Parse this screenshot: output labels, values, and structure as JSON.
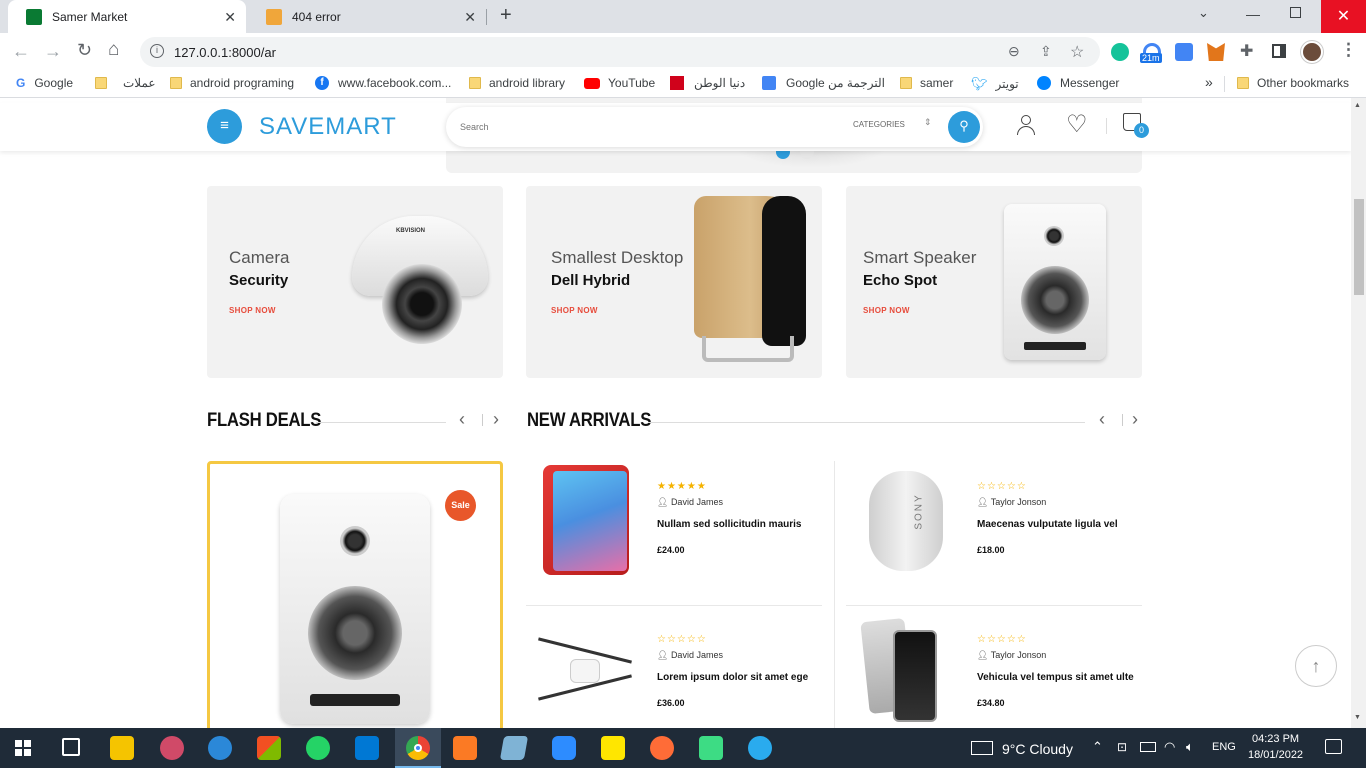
{
  "browser": {
    "tabs": [
      {
        "title": "Samer Market",
        "active": true
      },
      {
        "title": "404 error",
        "active": false
      }
    ],
    "new_tab_icon": "plus-icon",
    "url": "127.0.0.1:8000/ar",
    "extension_badge": "21m",
    "bookmarks": [
      {
        "label": "Google",
        "icon": "google-icon"
      },
      {
        "label": "عملات",
        "icon": "folder-icon"
      },
      {
        "label": "android programing",
        "icon": "folder-icon"
      },
      {
        "label": "www.facebook.com...",
        "icon": "facebook-icon"
      },
      {
        "label": "android library",
        "icon": "folder-icon"
      },
      {
        "label": "YouTube",
        "icon": "youtube-icon"
      },
      {
        "label": "دنيا الوطن",
        "icon": "site-icon"
      },
      {
        "label": "Google الترجمة من",
        "icon": "translate-icon"
      },
      {
        "label": "samer",
        "icon": "folder-icon"
      },
      {
        "label": "تويتر",
        "icon": "twitter-icon"
      },
      {
        "label": "Messenger",
        "icon": "messenger-icon"
      }
    ],
    "more_bookmarks": "»",
    "other_bookmarks": "Other bookmarks"
  },
  "site": {
    "logo": "SAVEMART",
    "search_placeholder": "Search",
    "categories_label": "CATEGORIES",
    "cart_count": "0",
    "accent": "#2d9cdb"
  },
  "banners": [
    {
      "subtitle": "Camera",
      "title": "Security",
      "cta": "SHOP NOW",
      "brand": "KBVISION"
    },
    {
      "subtitle": "Smallest Desktop",
      "title": "Dell Hybrid",
      "cta": "SHOP NOW"
    },
    {
      "subtitle": "Smart Speaker",
      "title": "Echo Spot",
      "cta": "SHOP NOW"
    }
  ],
  "flash_deals": {
    "heading": "FLASH DEALS",
    "badge": "Sale"
  },
  "new_arrivals": {
    "heading": "NEW ARRIVALS",
    "products": [
      {
        "author": "David James",
        "name": "Nullam sed sollicitudin mauris",
        "price": "£24.00",
        "rating": 5
      },
      {
        "author": "Taylor Jonson",
        "name": "Maecenas vulputate ligula vel",
        "price": "£18.00",
        "rating": 0
      },
      {
        "author": "David James",
        "name": "Lorem ipsum dolor sit amet ege",
        "price": "£36.00",
        "rating": 0
      },
      {
        "author": "Taylor Jonson",
        "name": "Vehicula vel tempus sit amet ulte",
        "price": "£34.80",
        "rating": 0
      }
    ]
  },
  "taskbar": {
    "weather": "9°C  Cloudy",
    "language": "ENG",
    "time": "04:23 PM",
    "date": "18/01/2022"
  }
}
